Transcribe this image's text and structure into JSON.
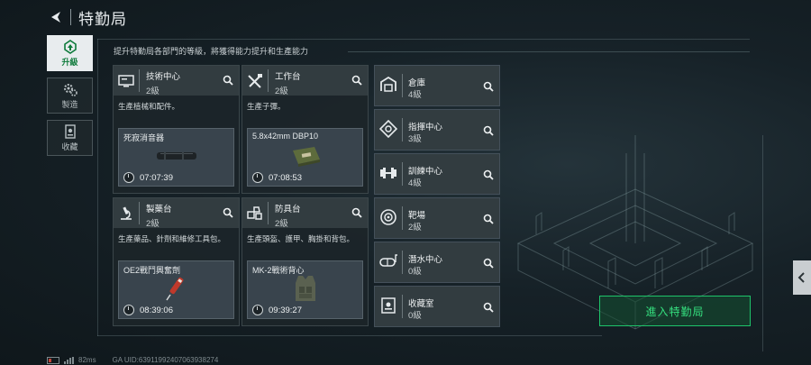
{
  "header": {
    "title": "特勤局"
  },
  "nav": [
    {
      "label": "升級",
      "icon": "upgrade-icon",
      "active": true
    },
    {
      "label": "製造",
      "icon": "gears-icon",
      "active": false
    },
    {
      "label": "收藏",
      "icon": "collection-icon",
      "active": false
    }
  ],
  "subtitle": "提升特勤局各部門的等級，將獲得能力提升和生產能力",
  "cards": [
    {
      "name": "技術中心",
      "level": "2級",
      "desc": "生產植械和配件。",
      "item": "死寂消音器",
      "time": "07:07:39",
      "icon": "monitor-icon"
    },
    {
      "name": "工作台",
      "level": "2級",
      "desc": "生產子彈。",
      "item": "5.8x42mm DBP10",
      "time": "07:08:53",
      "icon": "tools-icon"
    },
    {
      "name": "製藥台",
      "level": "2級",
      "desc": "生產藥品、針劑和維修工具包。",
      "item": "OE2戰鬥興奮劑",
      "time": "08:39:06",
      "icon": "microscope-icon"
    },
    {
      "name": "防具台",
      "level": "2級",
      "desc": "生產頭盔、護甲、胸掛和背包。",
      "item": "MK-2戰術背心",
      "time": "09:39:27",
      "icon": "armor-parts-icon"
    }
  ],
  "rooms": [
    {
      "name": "倉庫",
      "level": "4級",
      "icon": "warehouse-icon"
    },
    {
      "name": "指揮中心",
      "level": "3級",
      "icon": "command-icon"
    },
    {
      "name": "訓練中心",
      "level": "4級",
      "icon": "dumbbell-icon"
    },
    {
      "name": "靶場",
      "level": "2級",
      "icon": "target-icon"
    },
    {
      "name": "潛水中心",
      "level": "0級",
      "icon": "diving-mask-icon"
    },
    {
      "name": "收藏室",
      "level": "0級",
      "icon": "trophy-room-icon"
    }
  ],
  "enter_button": "進入特勤局",
  "footer": {
    "ping": "82ms",
    "uid": "GA UID:6391199240706393827​4"
  },
  "colors": {
    "accent": "#1ec46a",
    "active_nav": "#0d7a3a"
  }
}
